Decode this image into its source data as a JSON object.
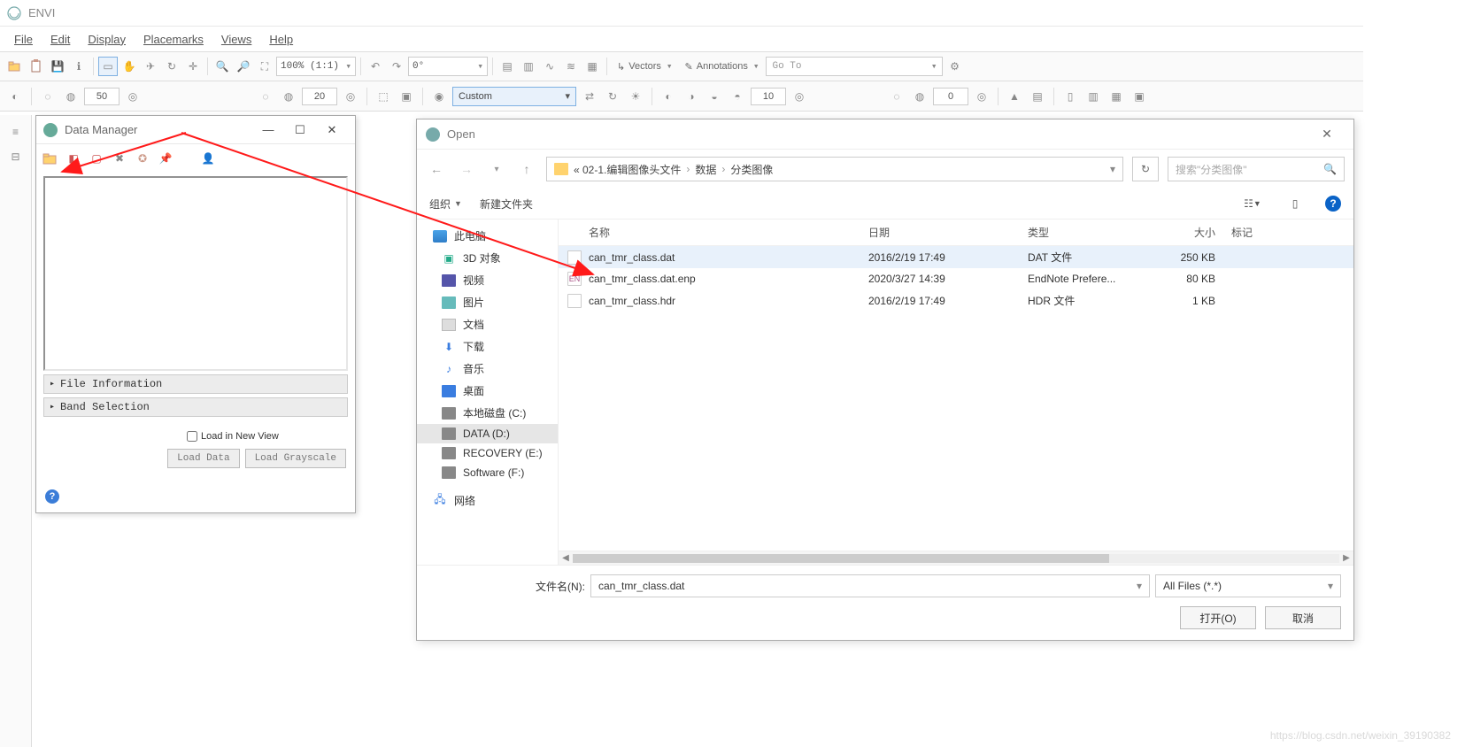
{
  "app": {
    "title": "ENVI"
  },
  "menu": {
    "file": "File",
    "edit": "Edit",
    "display": "Display",
    "placemarks": "Placemarks",
    "views": "Views",
    "help": "Help"
  },
  "tool1": {
    "zoom": "100% (1:1)",
    "rotate": "0°",
    "vectors": "Vectors",
    "annotations": "Annotations",
    "goto": "Go To"
  },
  "tool2": {
    "v1": "50",
    "v2": "20",
    "custom": "Custom",
    "v3": "10",
    "v4": "0"
  },
  "dm": {
    "title": "Data Manager",
    "sec1": "File Information",
    "sec2": "Band Selection",
    "load_new": "Load in New View",
    "btn_load": "Load Data",
    "btn_gray": "Load Grayscale"
  },
  "open": {
    "title": "Open",
    "crumb_root": "« 02-1.编辑图像头文件",
    "crumb1": "数据",
    "crumb2": "分类图像",
    "search_ph": "搜索\"分类图像\"",
    "organize": "组织",
    "newfolder": "新建文件夹",
    "cols": {
      "name": "名称",
      "date": "日期",
      "type": "类型",
      "size": "大小",
      "tag": "标记"
    },
    "tree": {
      "pc": "此电脑",
      "d3": "3D 对象",
      "video": "视频",
      "pic": "图片",
      "doc": "文档",
      "dl": "下载",
      "mus": "音乐",
      "desk": "桌面",
      "disk_c": "本地磁盘 (C:)",
      "disk_d": "DATA (D:)",
      "disk_e": "RECOVERY (E:)",
      "disk_f": "Software (F:)",
      "net": "网络"
    },
    "files": [
      {
        "name": "can_tmr_class.dat",
        "date": "2016/2/19 17:49",
        "type": "DAT 文件",
        "size": "250 KB"
      },
      {
        "name": "can_tmr_class.dat.enp",
        "date": "2020/3/27 14:39",
        "type": "EndNote Prefere...",
        "size": "80 KB"
      },
      {
        "name": "can_tmr_class.hdr",
        "date": "2016/2/19 17:49",
        "type": "HDR 文件",
        "size": "1 KB"
      }
    ],
    "fname_lbl": "文件名(N):",
    "fname_val": "can_tmr_class.dat",
    "filter": "All Files (*.*)",
    "btn_open": "打开(O)",
    "btn_cancel": "取消"
  },
  "watermark": "https://blog.csdn.net/weixin_39190382"
}
